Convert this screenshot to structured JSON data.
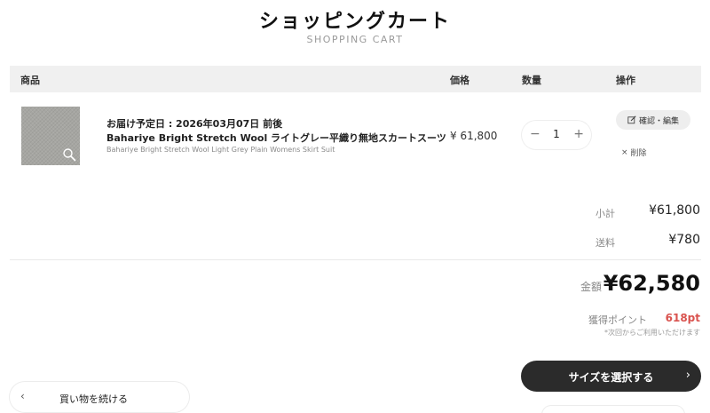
{
  "header": {
    "title": "ショッピングカート",
    "subtitle": "SHOPPING CART"
  },
  "table_header": {
    "columns": [
      "商品",
      "価格",
      "数量",
      "操作"
    ]
  },
  "cart_item": {
    "thumbnail_icon": "zoom-icon",
    "delivery_date": "お届け予定日 : 2026年03月07日 前後",
    "name_ja": "Bahariye Bright Stretch Wool ライトグレー平織り無地スカートスーツ",
    "name_en": "Bahariye Bright Stretch Wool Light Grey Plain Womens Skirt Suit",
    "price": "¥ 61,800",
    "quantity": "1",
    "minus_symbol": "−",
    "plus_symbol": "+",
    "edit_label": "確認・編集",
    "delete_label": "削除",
    "delete_symbol": "×"
  },
  "summary": {
    "subtotal_label": "小計",
    "subtotal_value": "¥61,800",
    "shipping_label": "送料",
    "shipping_value": "¥780",
    "total_label": "金額",
    "total_value": "¥62,580",
    "points_label": "獲得ポイント",
    "points_value": "618pt",
    "points_note": "*次回からご利用いただけます"
  },
  "actions": {
    "select_size_label": "サイズを選択する",
    "select_size_chevron": "›",
    "continue_label": "買い物を続ける",
    "continue_chevron": "‹"
  },
  "colors": {
    "primary_button": "#2b2b2b",
    "points_accent": "#d9534f",
    "table_header_bg": "#f0f0f0"
  }
}
